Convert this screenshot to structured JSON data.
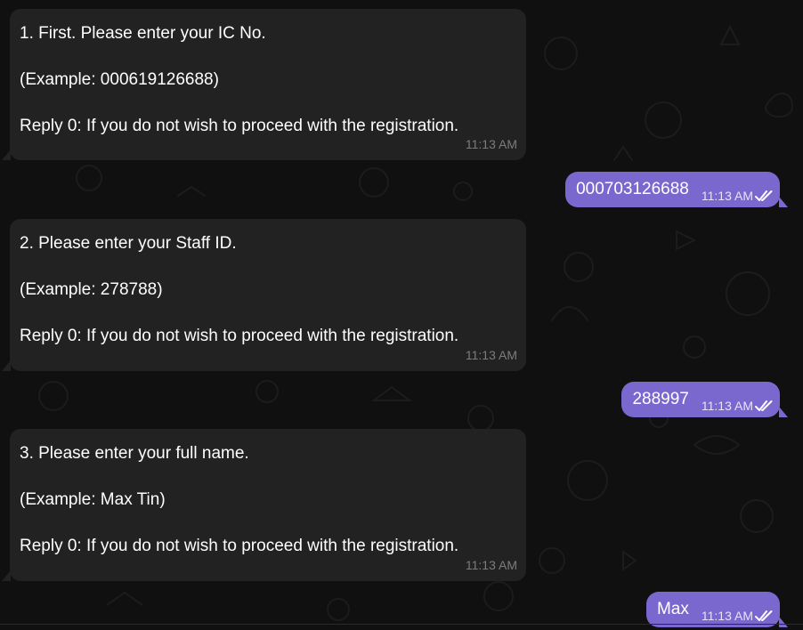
{
  "messages": [
    {
      "direction": "incoming",
      "line1": "1. First. Please enter your IC No.",
      "line2": "(Example: 000619126688)",
      "line3": "Reply 0: If you do not wish to proceed with the registration.",
      "time": "11:13 AM"
    },
    {
      "direction": "outgoing",
      "text": "000703126688",
      "time": "11:13 AM",
      "status": "double-check"
    },
    {
      "direction": "incoming",
      "line1": "2. Please enter your Staff ID.",
      "line2": "(Example: 278788)",
      "line3": "Reply 0: If you do not wish to proceed with the registration.",
      "time": "11:13 AM"
    },
    {
      "direction": "outgoing",
      "text": "288997",
      "time": "11:13 AM",
      "status": "double-check"
    },
    {
      "direction": "incoming",
      "line1": "3. Please enter your full name.",
      "line2": "(Example: Max Tin)",
      "line3": "Reply 0: If you do not wish to proceed with the registration.",
      "time": "11:13 AM"
    },
    {
      "direction": "outgoing",
      "text": "Max",
      "time": "11:13 AM",
      "status": "double-check"
    }
  ],
  "colors": {
    "background": "#101010",
    "incoming_bubble": "#222222",
    "outgoing_bubble": "#7b68cf",
    "timestamp_incoming": "#7c7c7c"
  }
}
